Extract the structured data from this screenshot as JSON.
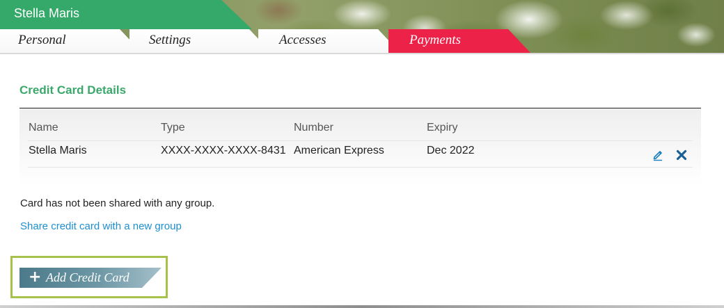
{
  "header": {
    "user_name": "Stella Maris",
    "tabs": [
      {
        "label": "Personal",
        "active": false
      },
      {
        "label": "Settings",
        "active": false
      },
      {
        "label": "Accesses",
        "active": false
      },
      {
        "label": "Payments",
        "active": true
      }
    ]
  },
  "colors": {
    "brand_green": "#35a96a",
    "active_tab": "#ec2249",
    "link_blue": "#1d8fd0",
    "focus_outline": "#a6c24a",
    "button_teal": "#4b7a8a"
  },
  "credit_cards": {
    "title": "Credit Card Details",
    "columns": [
      "Name",
      "Type",
      "Number",
      "Expiry"
    ],
    "rows": [
      {
        "name": "Stella Maris",
        "type": "XXXX-XXXX-XXXX-8431",
        "number": "American Express",
        "expiry": "Dec 2022",
        "actions": [
          "pencil-icon",
          "x-icon"
        ]
      }
    ]
  },
  "sharing": {
    "status": "Card has not been shared with any group.",
    "link": "Share credit card with a new group"
  },
  "actions": {
    "add_card_label": "Add Credit Card",
    "add_card_icon": "plus-icon"
  }
}
